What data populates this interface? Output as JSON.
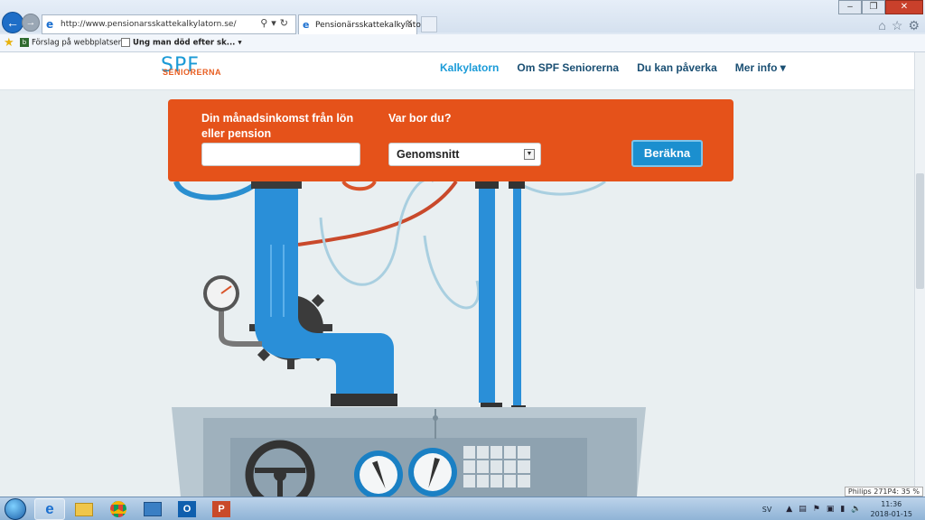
{
  "browser": {
    "url": "http://www.pensionarsskattekalkylatorn.se/",
    "tab_title": "Pensionärsskattekalkylatorn",
    "favorites": [
      {
        "label": "Förslag på webbplatser ▾"
      },
      {
        "label": "Ung man död efter sk... ▾"
      }
    ],
    "window_controls": [
      "–",
      "❐",
      "✕"
    ]
  },
  "site": {
    "logo_text": "SPF",
    "logo_sub": "SENIORERNA",
    "nav": [
      {
        "label": "Kalkylatorn",
        "active": true
      },
      {
        "label": "Om SPF Seniorerna",
        "active": false
      },
      {
        "label": "Du kan påverka",
        "active": false
      },
      {
        "label": "Mer info ▾",
        "active": false
      }
    ]
  },
  "calculator": {
    "income_label": "Din månadsinkomst från lön eller pension",
    "income_value": "",
    "location_label": "Var bor du?",
    "location_selected": "Genomsnitt",
    "submit_label": "Beräkna"
  },
  "colors": {
    "calc_bg": "#e5521a",
    "button": "#1b8fcf",
    "nav_active": "#1a9bd8",
    "nav": "#1a4f73"
  },
  "taskbar": {
    "apps": [
      "ie-icon",
      "folder-icon",
      "chrome-icon",
      "explorer-icon",
      "outlook-icon",
      "powerpoint-icon"
    ],
    "language": "SV",
    "time": "11:36",
    "date": "2018-01-15",
    "monitor_badge": "Philips 271P4: 35 %"
  }
}
